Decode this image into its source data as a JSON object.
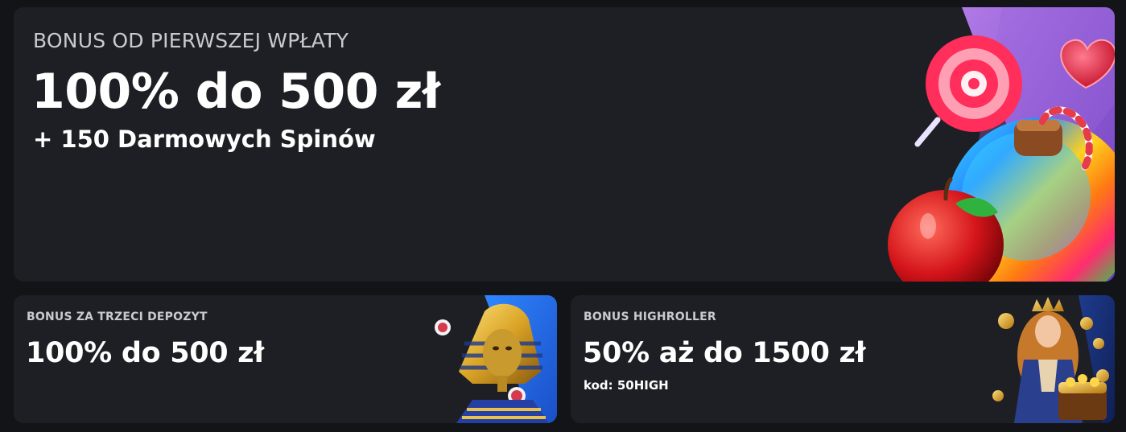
{
  "main_bonus": {
    "eyebrow": "BONUS OD PIERWSZEJ WPŁATY",
    "title": "100% do 500 zł",
    "subtitle": "+ 150 Darmowych Spinów",
    "art_icon": "candy-apple-lollipop-illustration"
  },
  "third_deposit": {
    "eyebrow": "BONUS ZA TRZECI DEPOZYT",
    "title": "100% do 500 zł",
    "art_icon": "pharaoh-illustration"
  },
  "highroller": {
    "eyebrow": "BONUS HIGHROLLER",
    "title": "50% aż do 1500 zł",
    "code": "kod: 50HIGH",
    "art_icon": "queen-treasure-illustration"
  },
  "colors": {
    "background": "#131417",
    "card": "#1e1f24",
    "accent_purple": "#8e5ad6",
    "accent_blue": "#1f6fe0"
  }
}
